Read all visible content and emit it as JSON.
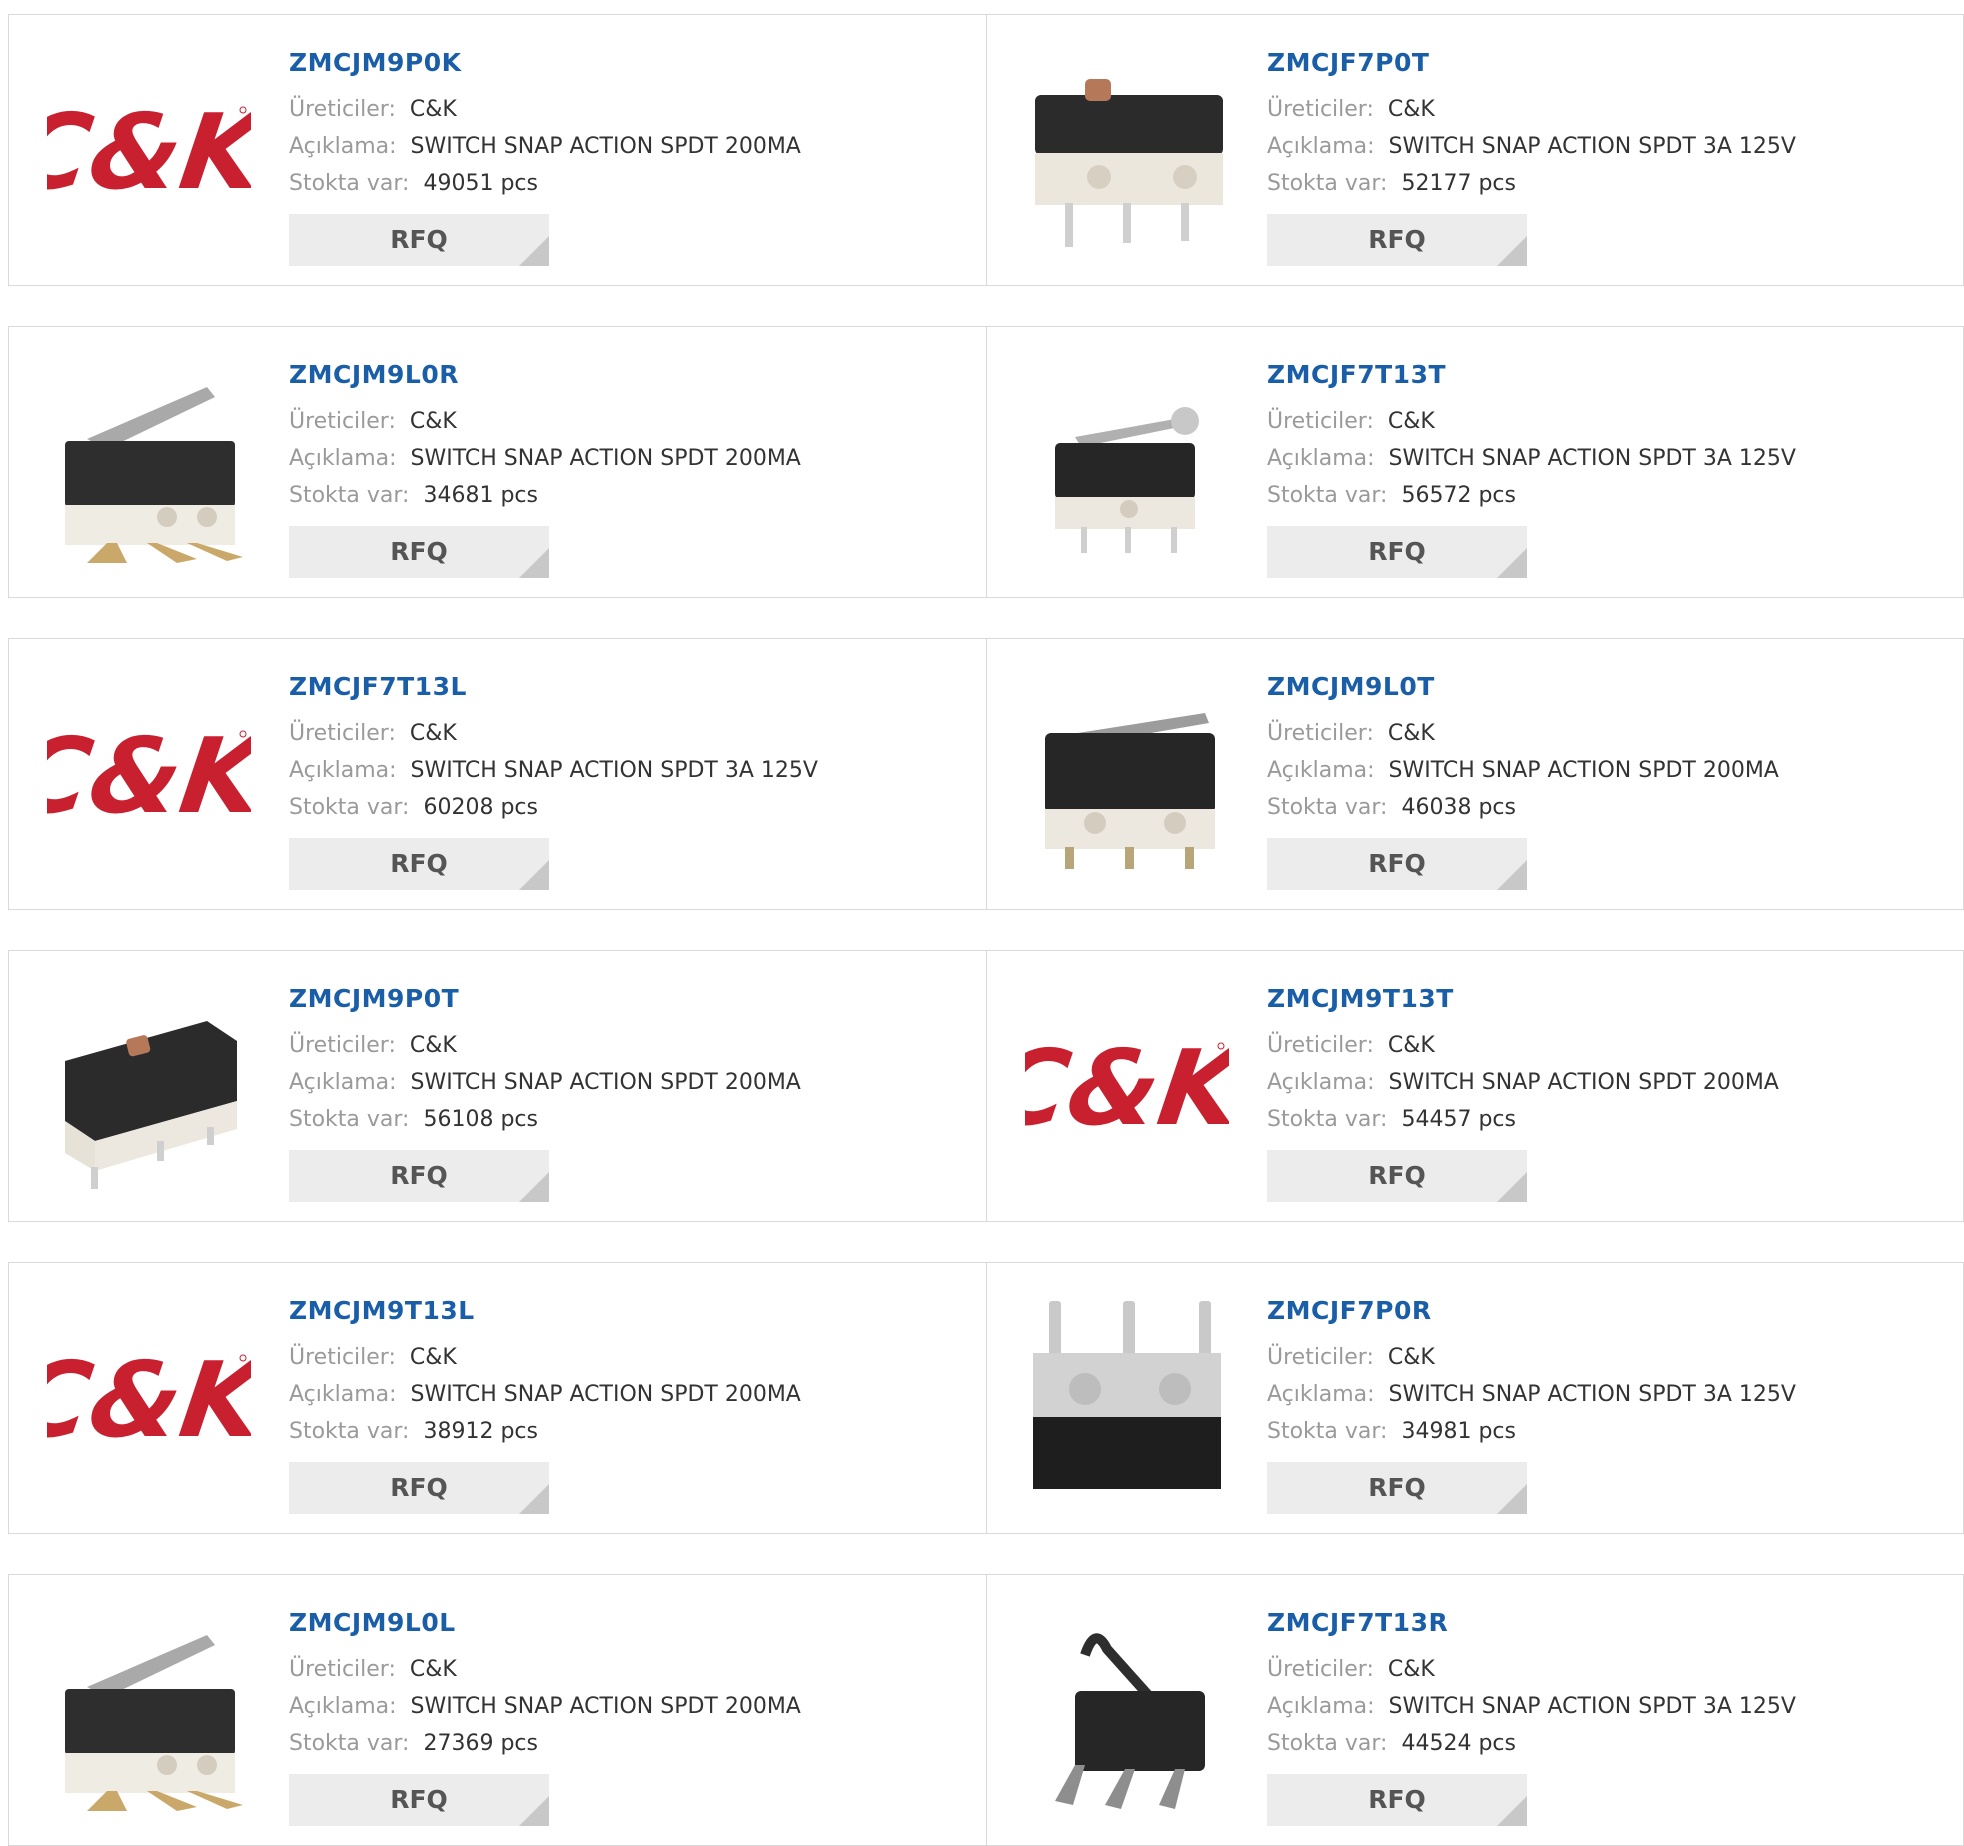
{
  "labels": {
    "manufacturer": "Üreticiler:",
    "description": "Açıklama:",
    "stock": "Stokta var:",
    "rfq": "RFQ"
  },
  "colors": {
    "link": "#1a5ea8",
    "brand_red": "#c8202f",
    "button_bg": "#ececec"
  },
  "products": [
    {
      "part": "ZMCJM9P0K",
      "manufacturer": "C&K",
      "description": "SWITCH SNAP ACTION SPDT 200MA",
      "stock": "49051 pcs",
      "image": "ck-logo-icon"
    },
    {
      "part": "ZMCJF7P0T",
      "manufacturer": "C&K",
      "description": "SWITCH SNAP ACTION SPDT 3A 125V",
      "stock": "52177 pcs",
      "image": "switch-plunger-icon"
    },
    {
      "part": "ZMCJM9L0R",
      "manufacturer": "C&K",
      "description": "SWITCH SNAP ACTION SPDT 200MA",
      "stock": "34681 pcs",
      "image": "switch-lever-angled-icon"
    },
    {
      "part": "ZMCJF7T13T",
      "manufacturer": "C&K",
      "description": "SWITCH SNAP ACTION SPDT 3A 125V",
      "stock": "56572 pcs",
      "image": "switch-roller-lever-icon"
    },
    {
      "part": "ZMCJF7T13L",
      "manufacturer": "C&K",
      "description": "SWITCH SNAP ACTION SPDT 3A 125V",
      "stock": "60208 pcs",
      "image": "ck-logo-icon"
    },
    {
      "part": "ZMCJM9L0T",
      "manufacturer": "C&K",
      "description": "SWITCH SNAP ACTION SPDT 200MA",
      "stock": "46038 pcs",
      "image": "switch-lever-icon"
    },
    {
      "part": "ZMCJM9P0T",
      "manufacturer": "C&K",
      "description": "SWITCH SNAP ACTION SPDT 200MA",
      "stock": "56108 pcs",
      "image": "switch-plunger-side-icon"
    },
    {
      "part": "ZMCJM9T13T",
      "manufacturer": "C&K",
      "description": "SWITCH SNAP ACTION SPDT 200MA",
      "stock": "54457 pcs",
      "image": "ck-logo-icon"
    },
    {
      "part": "ZMCJM9T13L",
      "manufacturer": "C&K",
      "description": "SWITCH SNAP ACTION SPDT 200MA",
      "stock": "38912 pcs",
      "image": "ck-logo-icon"
    },
    {
      "part": "ZMCJF7P0R",
      "manufacturer": "C&K",
      "description": "SWITCH SNAP ACTION SPDT 3A 125V",
      "stock": "34981 pcs",
      "image": "switch-bottom-view-icon"
    },
    {
      "part": "ZMCJM9L0L",
      "manufacturer": "C&K",
      "description": "SWITCH SNAP ACTION SPDT 200MA",
      "stock": "27369 pcs",
      "image": "switch-lever-angled-icon"
    },
    {
      "part": "ZMCJF7T13R",
      "manufacturer": "C&K",
      "description": "SWITCH SNAP ACTION SPDT 3A 125V",
      "stock": "44524 pcs",
      "image": "switch-hook-lever-icon"
    }
  ]
}
